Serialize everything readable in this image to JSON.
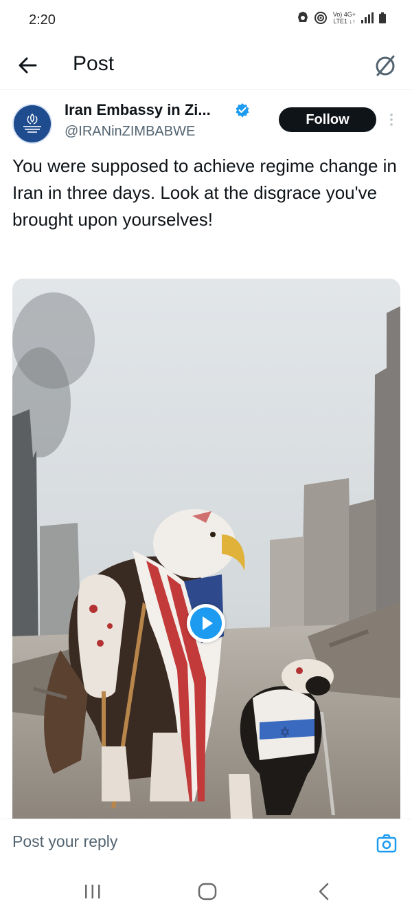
{
  "status_bar": {
    "time": "2:20",
    "network_top": "Vo) 4G+",
    "network_bottom": "LTE1 ↓↑"
  },
  "header": {
    "title": "Post",
    "back_icon": "arrow-left-icon",
    "grok_icon": "grok-slash-circle-icon"
  },
  "post": {
    "author_name": "Iran Embassy in Zi...",
    "handle": "@IRANinZIMBABWE",
    "verified_color": "#1d9bf0",
    "follow_label": "Follow",
    "text": "You were supposed to achieve regime change in Iran in three days. Look at the disgrace you've brought upon yourselves!",
    "media": {
      "type": "video",
      "play_icon": "play-icon"
    }
  },
  "reply": {
    "placeholder": "Post your reply",
    "camera_icon": "camera-icon",
    "accent": "#1d9bf0"
  },
  "nav": {
    "recents_icon": "recents-icon",
    "home_icon": "home-icon",
    "back_icon": "chevron-left-icon"
  }
}
